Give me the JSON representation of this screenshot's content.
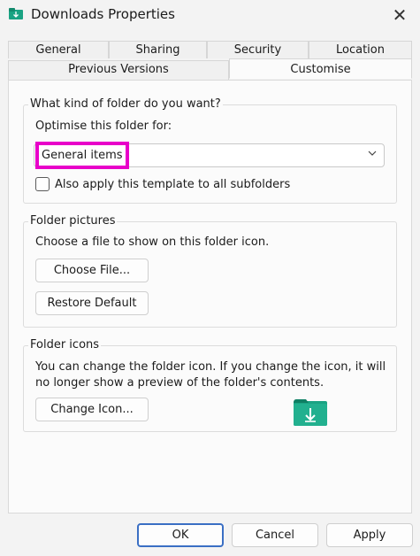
{
  "window": {
    "title": "Downloads Properties",
    "close_glyph": "✕",
    "icon": "folder-download-icon"
  },
  "tabs": {
    "row1": [
      "General",
      "Sharing",
      "Security",
      "Location"
    ],
    "row2": [
      "Previous Versions",
      "Customise"
    ],
    "active": "Customise"
  },
  "folder_type": {
    "title": "What kind of folder do you want?",
    "optimise_label": "Optimise this folder for:",
    "selected": "General items",
    "apply_subfolders_label": "Also apply this template to all subfolders",
    "apply_subfolders_checked": false
  },
  "folder_pictures": {
    "title": "Folder pictures",
    "description": "Choose a file to show on this folder icon.",
    "choose_file_label": "Choose File...",
    "restore_default_label": "Restore Default"
  },
  "folder_icons": {
    "title": "Folder icons",
    "description_line1": "You can change the folder icon. If you change the icon, it will",
    "description_line2": "no longer show a preview of the folder's contents.",
    "change_icon_label": "Change Icon..."
  },
  "footer": {
    "ok_label": "OK",
    "cancel_label": "Cancel",
    "apply_label": "Apply"
  },
  "colors": {
    "accent": "#3a6fc4",
    "highlight": "#e800c9",
    "folder": "#1aa383"
  }
}
